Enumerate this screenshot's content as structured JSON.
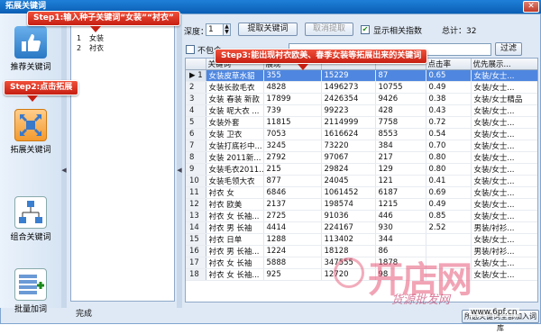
{
  "window": {
    "title": "拓展关键词",
    "close": "✕"
  },
  "sidebar": {
    "items": [
      {
        "label": "推荐关键词",
        "icon": "thumbs-up-icon"
      },
      {
        "label": "拓展关键词",
        "icon": "expand-arrows-icon",
        "active": true
      },
      {
        "label": "组合关键词",
        "icon": "tree-structure-icon"
      },
      {
        "label": "批量加词",
        "icon": "batch-add-grid-icon"
      }
    ]
  },
  "seed_words": [
    {
      "index": "1",
      "word": "女装"
    },
    {
      "index": "2",
      "word": "衬衣"
    }
  ],
  "controls": {
    "depth_label": "深度：",
    "depth_value": "1",
    "extract_button": "提取关键词",
    "cancel_button": "取消提取",
    "show_index_label": "显示相关指数",
    "total_label": "总计：32",
    "exclude_label": "不包含",
    "filter_button": "过滤"
  },
  "table": {
    "columns": [
      "",
      "关键词",
      "展现",
      "",
      "",
      "点击率",
      "优先展示..."
    ],
    "rows": [
      [
        "1",
        "女装皮草水貂",
        "355",
        "15229",
        "87",
        "0.65",
        "女装/女士..."
      ],
      [
        "2",
        "女装长款毛衣",
        "4828",
        "1496273",
        "10755",
        "0.49",
        "女装/女士..."
      ],
      [
        "3",
        "女装 春装 新款",
        "17899",
        "2426354",
        "9426",
        "0.38",
        "女装/女士精品"
      ],
      [
        "4",
        "女装 呢大衣 ...",
        "739",
        "99223",
        "428",
        "0.43",
        "女装/女士..."
      ],
      [
        "5",
        "女装外套",
        "11815",
        "2114999",
        "7758",
        "0.72",
        "女装/女士..."
      ],
      [
        "6",
        "女装 卫衣",
        "7053",
        "1616624",
        "8553",
        "0.54",
        "女装/女士..."
      ],
      [
        "7",
        "女装打底衫中...",
        "3245",
        "73220",
        "384",
        "0.70",
        "女装/女士..."
      ],
      [
        "8",
        "女装 2011新...",
        "2792",
        "97067",
        "217",
        "0.80",
        "女装/女士..."
      ],
      [
        "9",
        "女装毛衣2011...",
        "215",
        "29824",
        "129",
        "0.80",
        "女装/女士..."
      ],
      [
        "10",
        "女装毛领大衣",
        "877",
        "24045",
        "121",
        "0.41",
        "女装/女士..."
      ],
      [
        "11",
        "衬衣 女",
        "6846",
        "1061452",
        "6187",
        "0.69",
        "女装/女士..."
      ],
      [
        "12",
        "衬衣 欧美",
        "2137",
        "198574",
        "1215",
        "0.49",
        "女装/女士..."
      ],
      [
        "13",
        "衬衣 女 长袖...",
        "2725",
        "91036",
        "446",
        "0.85",
        "女装/女士..."
      ],
      [
        "14",
        "衬衣 男 长袖",
        "4414",
        "224167",
        "930",
        "2.52",
        "男装/衬衫..."
      ],
      [
        "15",
        "衬衣 日单",
        "1288",
        "113402",
        "344",
        "",
        "女装/女士..."
      ],
      [
        "16",
        "衬衣 男 长袖...",
        "1224",
        "18128",
        "86",
        "",
        "男装/衬衫..."
      ],
      [
        "17",
        "衬衣 女 长袖",
        "5888",
        "347555",
        "1878",
        "",
        "女装/女士..."
      ],
      [
        "18",
        "衬衣 女 长袖...",
        "925",
        "12720",
        "98",
        "",
        "女装/女士..."
      ]
    ]
  },
  "status": "完成",
  "bottom_button": "所选关键词全部加入词库",
  "callouts": {
    "step1": "Step1:输入种子关键词“女装”“衬衣”",
    "step2": "Step2:点击拓展",
    "step3": "Step3:能出现衬衣欧美、春季女装等拓展出来的关键词"
  },
  "watermark": {
    "big": "开店网",
    "sub": "货源批发网",
    "url": "www.6pf.cn"
  },
  "colors": {
    "selected_row": "#4f87e0",
    "callout_red": "#d22a1a",
    "titlebar": "#1673cc"
  }
}
